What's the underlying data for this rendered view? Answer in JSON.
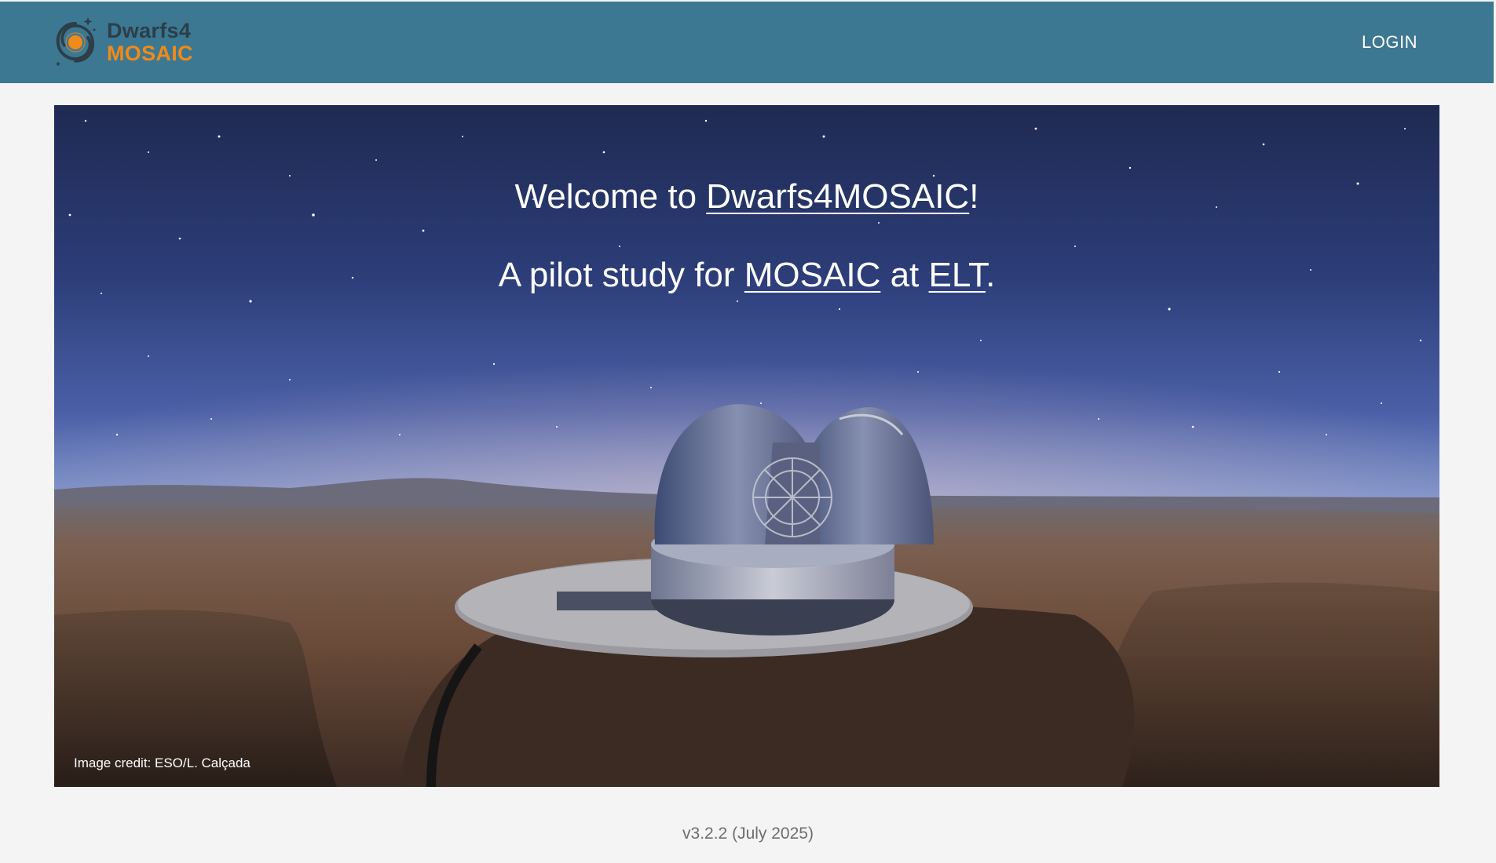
{
  "navbar": {
    "brand_line1": "Dwarfs4",
    "brand_line2": "MOSAIC",
    "login_label": "LOGIN",
    "background_color": "#3d7892",
    "brand_accent_color": "#f08a19"
  },
  "hero": {
    "welcome_prefix": "Welcome to ",
    "welcome_link": "Dwarfs4MOSAIC",
    "welcome_suffix": "!",
    "pilot_prefix": "A pilot study for ",
    "pilot_link_mosaic": "MOSAIC",
    "pilot_middle": " at ",
    "pilot_link_elt": "ELT",
    "pilot_suffix": ".",
    "image_credit": "Image credit: ESO/L. Calçada"
  },
  "footer": {
    "version": "v3.2.2 (July 2025)"
  }
}
